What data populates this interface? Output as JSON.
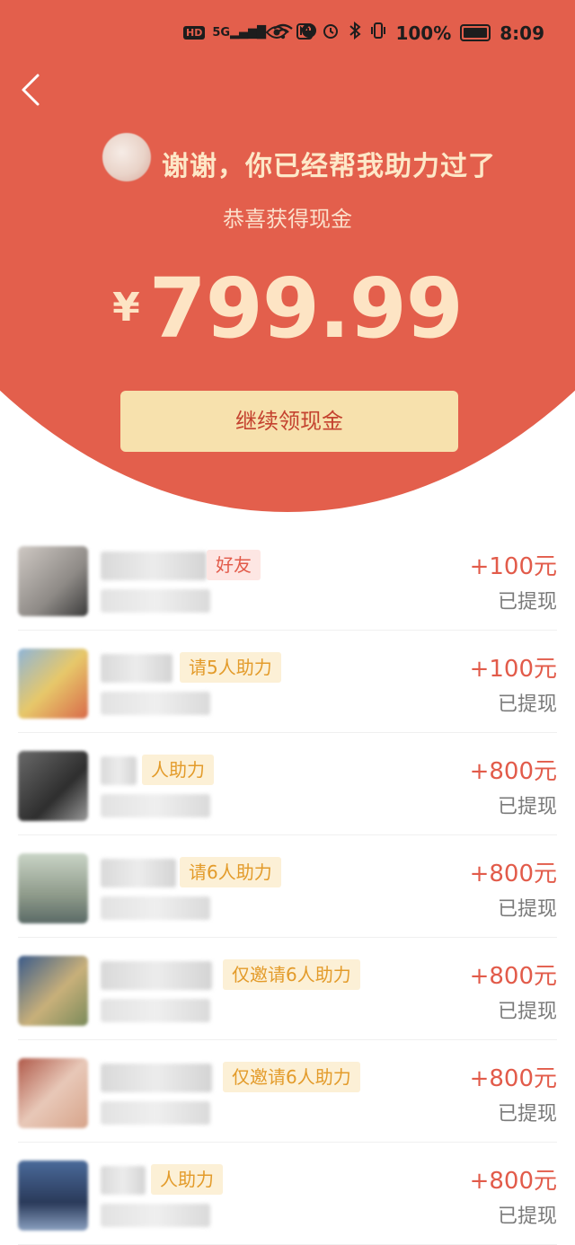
{
  "status_bar": {
    "left_icons": [
      "hd-icon",
      "signal-5g-icon",
      "wifi-icon",
      "data-icon"
    ],
    "right_icons": [
      "eye-icon",
      "nfc-icon",
      "alarm-icon",
      "bluetooth-icon",
      "vibrate-icon"
    ],
    "battery": "100%",
    "time": "8:09"
  },
  "header": {
    "back_icon": "chevron-left-icon",
    "thanks_text": "谢谢，你已经帮我助力过了",
    "subtitle": "恭喜获得现金",
    "currency": "¥",
    "amount": "799.99",
    "cta_label": "继续领现金"
  },
  "colors": {
    "hero_red": "#e35f4c",
    "cta_bg": "#f7e1ad",
    "amount_red": "#e25b4a"
  },
  "list": [
    {
      "tag": "好友",
      "tag_style": "pink",
      "amount": "+100元",
      "status": "已提现"
    },
    {
      "tag": "请5人助力",
      "tag_style": "gold",
      "amount": "+100元",
      "status": "已提现"
    },
    {
      "tag": "人助力",
      "tag_style": "gold",
      "amount": "+800元",
      "status": "已提现"
    },
    {
      "tag": "请6人助力",
      "tag_style": "gold",
      "amount": "+800元",
      "status": "已提现"
    },
    {
      "tag": "仅邀请6人助力",
      "tag_style": "gold",
      "amount": "+800元",
      "status": "已提现"
    },
    {
      "tag": "仅邀请6人助力",
      "tag_style": "gold",
      "amount": "+800元",
      "status": "已提现"
    },
    {
      "tag": "人助力",
      "tag_style": "gold",
      "amount": "+800元",
      "status": "已提现"
    }
  ]
}
